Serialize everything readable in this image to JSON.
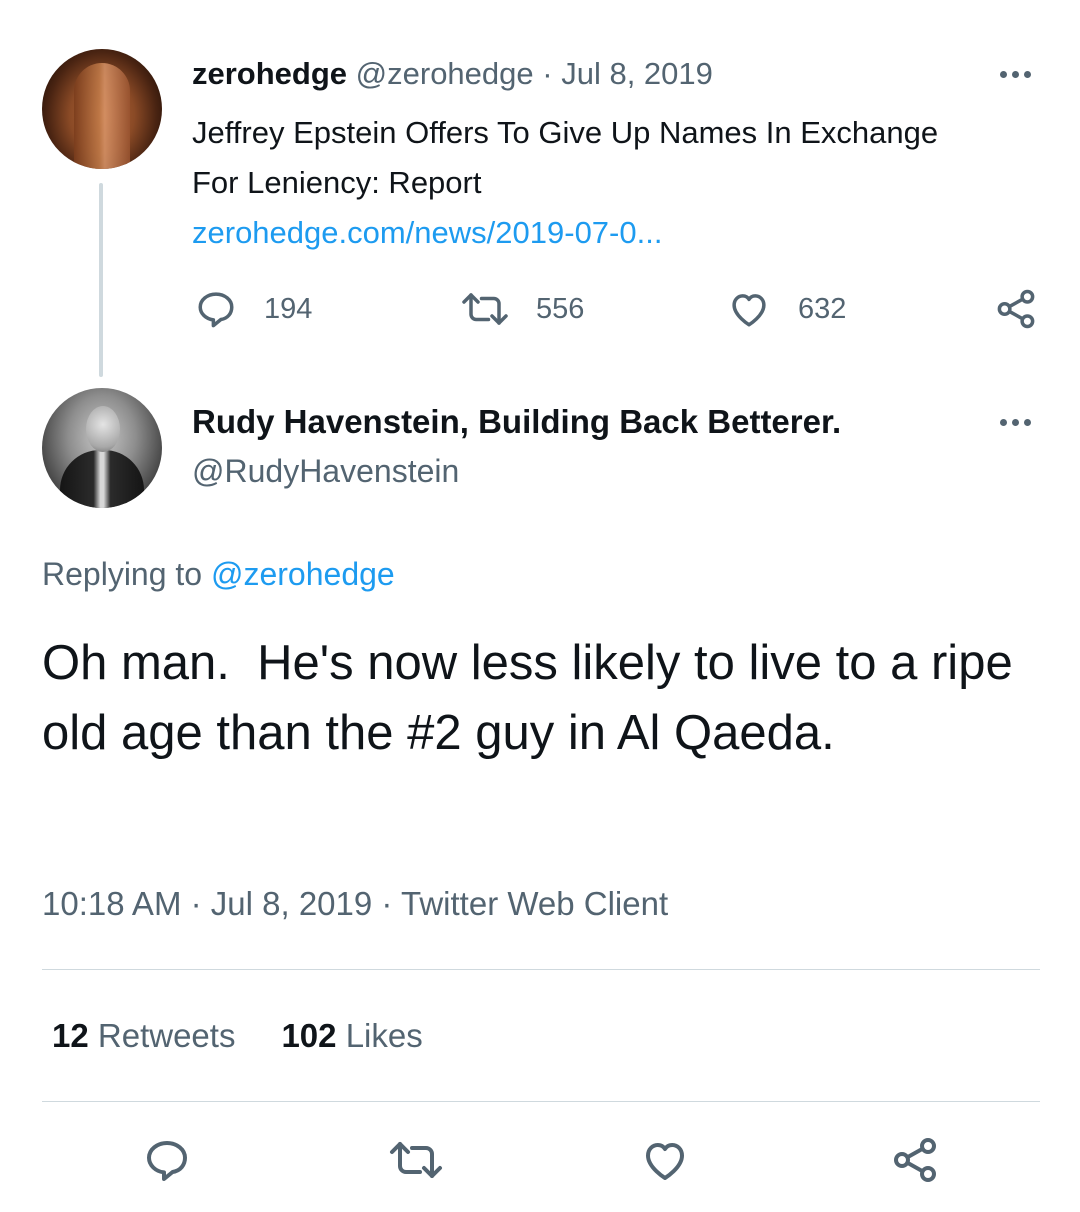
{
  "original_tweet": {
    "author_name": "zerohedge",
    "author_handle": "@zerohedge",
    "separator": "·",
    "date": "Jul 8, 2019",
    "text": "Jeffrey Epstein Offers To Give Up Names In Exchange For Leniency: Report",
    "link": "zerohedge.com/news/2019-07-0...",
    "actions": {
      "replies": "194",
      "retweets": "556",
      "likes": "632"
    }
  },
  "reply_tweet": {
    "author_name": "Rudy Havenstein, Building Back Betterer.",
    "author_handle": "@RudyHavenstein",
    "replying_label": "Replying to",
    "replying_to": "@zerohedge",
    "text": "Oh man.  He's now less likely to live to a ripe old age than the #2 guy in Al Qaeda.",
    "time": "10:18 AM",
    "separator": "·",
    "date": "Jul 8, 2019",
    "client": "Twitter Web Client",
    "retweets_count": "12",
    "retweets_label": "Retweets",
    "likes_count": "102",
    "likes_label": "Likes"
  },
  "colors": {
    "link": "#1d9bf0",
    "muted": "#536471",
    "text": "#0f1419",
    "divider": "#cfd9de"
  },
  "icons": [
    "more-icon",
    "reply-icon",
    "retweet-icon",
    "like-icon",
    "share-icon"
  ]
}
